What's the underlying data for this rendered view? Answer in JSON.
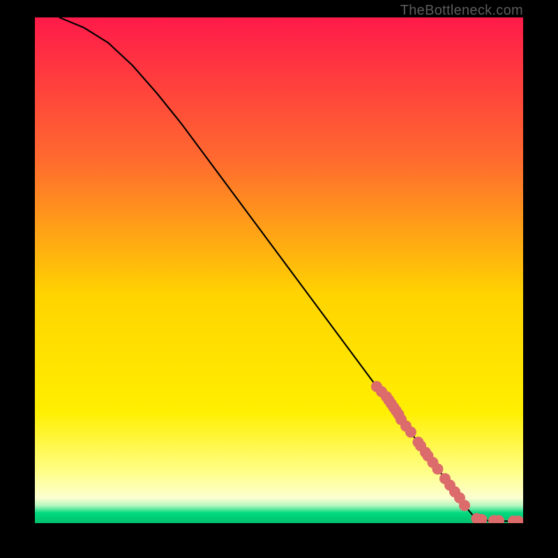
{
  "watermark": "TheBottleneck.com",
  "chart_data": {
    "type": "line",
    "title": "",
    "xlabel": "",
    "ylabel": "",
    "xlim": [
      0,
      100
    ],
    "ylim": [
      0,
      100
    ],
    "background_gradient": {
      "top": "#ff1a4a",
      "mid1": "#ff8a2a",
      "mid2": "#ffe500",
      "mid3": "#ffff7a",
      "bottom_band": "#00d97e"
    },
    "curve": {
      "x": [
        5,
        10,
        15,
        20,
        25,
        30,
        35,
        40,
        45,
        50,
        55,
        60,
        65,
        70,
        75,
        80,
        85,
        88,
        90,
        92,
        94,
        96,
        98,
        100
      ],
      "y": [
        100,
        98,
        95,
        90.5,
        85,
        79,
        72.5,
        66,
        59.5,
        53,
        46.5,
        40,
        33.5,
        27,
        20.5,
        14,
        7.5,
        3.5,
        1.2,
        0.6,
        0.4,
        0.4,
        0.4,
        0.4
      ]
    },
    "points": {
      "color": "#dc6b6b",
      "x": [
        70,
        71,
        72,
        72.5,
        73,
        73.5,
        74,
        74.5,
        75,
        76,
        77,
        78.5,
        79,
        80,
        80.5,
        81.5,
        82.5,
        84,
        85,
        86,
        87,
        88,
        90.5,
        91.5,
        94,
        95,
        98,
        99
      ],
      "y": [
        27,
        26,
        25,
        24.3,
        23.6,
        22.9,
        22.2,
        21.5,
        20.5,
        19.2,
        18,
        16,
        15.3,
        14,
        13.3,
        12,
        10.7,
        8.8,
        7.5,
        6.2,
        5,
        3.5,
        0.9,
        0.7,
        0.5,
        0.5,
        0.4,
        0.4
      ]
    }
  }
}
